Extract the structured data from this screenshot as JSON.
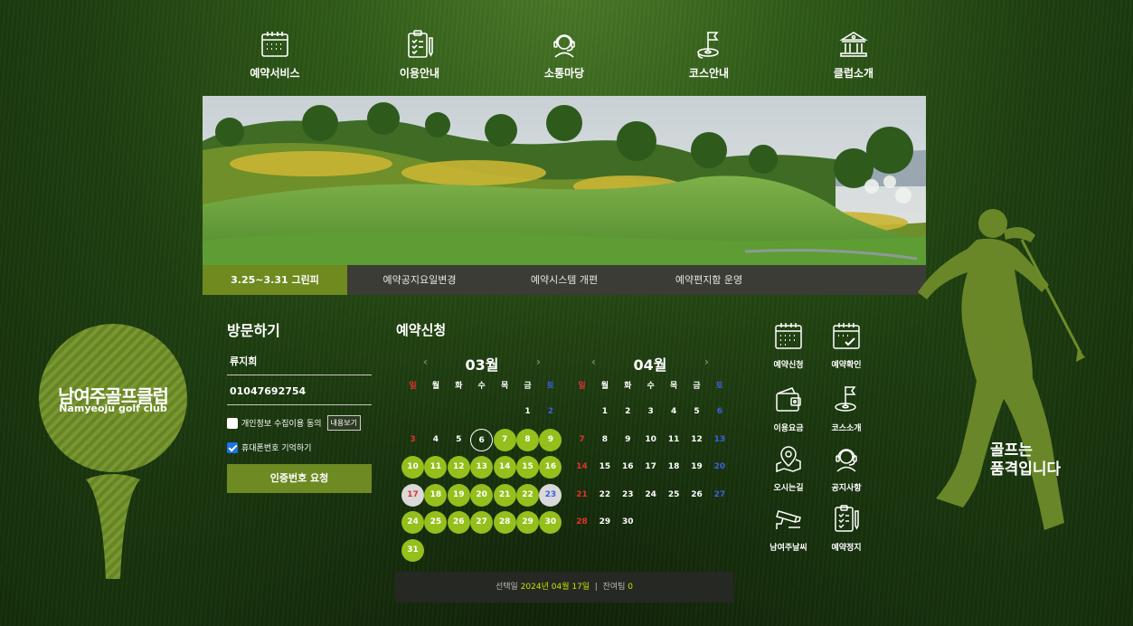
{
  "nav": {
    "items": [
      {
        "label": "예약서비스",
        "icon": "calendar-icon"
      },
      {
        "label": "이용안내",
        "icon": "clipboard-pen-icon"
      },
      {
        "label": "소통마당",
        "icon": "headset-icon"
      },
      {
        "label": "코스안내",
        "icon": "golf-flag-icon"
      },
      {
        "label": "클럽소개",
        "icon": "clubhouse-icon"
      }
    ]
  },
  "notices": {
    "tabs": [
      "3.25~3.31 그린피",
      "예약공지요일변경",
      "예약시스템 개편",
      "예약편지함 운영"
    ],
    "active_index": 0
  },
  "logo": {
    "korean": "남여주골프클럽",
    "english": "Namyeoju golf club"
  },
  "visit": {
    "title": "방문하기",
    "name_value": "류지희",
    "phone_value": "01047692754",
    "privacy_label": "개인정보 수집이용 동의",
    "privacy_checked": false,
    "terms_button": "내용보기",
    "remember_label": "휴대폰번호 기억하기",
    "remember_checked": true,
    "request_button": "인증번호 요청"
  },
  "reservation": {
    "title": "예약신청",
    "weekdays": [
      "일",
      "월",
      "화",
      "수",
      "목",
      "금",
      "토"
    ],
    "months": [
      {
        "label": "03월",
        "first_weekday": 5,
        "days": 31,
        "available": [
          7,
          8,
          9,
          10,
          11,
          12,
          13,
          14,
          15,
          16,
          18,
          19,
          20,
          21,
          22,
          24,
          25,
          26,
          27,
          28,
          29,
          30,
          31
        ],
        "today": 6,
        "selected_unavailable": [
          17,
          23
        ]
      },
      {
        "label": "04월",
        "first_weekday": 1,
        "days": 30,
        "available": [],
        "today": null,
        "selected_unavailable": []
      }
    ],
    "status": {
      "selected_label": "선택일",
      "selected_date": "2024년 04월 17일",
      "remain_label": "잔여팀",
      "remain_value": "0"
    }
  },
  "quick_links": [
    {
      "label": "예약신청",
      "icon": "calendar-icon"
    },
    {
      "label": "예약확인",
      "icon": "calendar-check-icon"
    },
    {
      "label": "이용요금",
      "icon": "wallet-icon"
    },
    {
      "label": "코스소개",
      "icon": "golf-flag-icon"
    },
    {
      "label": "오시는길",
      "icon": "map-pin-icon"
    },
    {
      "label": "공지사항",
      "icon": "headset-icon"
    },
    {
      "label": "남여주날씨",
      "icon": "cctv-icon"
    },
    {
      "label": "예약정지",
      "icon": "clipboard-pen-icon"
    }
  ],
  "slogan": [
    "골프는",
    "품격입니다"
  ],
  "colors": {
    "accent": "#95bf1c",
    "tab_active": "#6f8a1f",
    "sunday": "#e0322e",
    "saturday": "#3a62e0"
  }
}
